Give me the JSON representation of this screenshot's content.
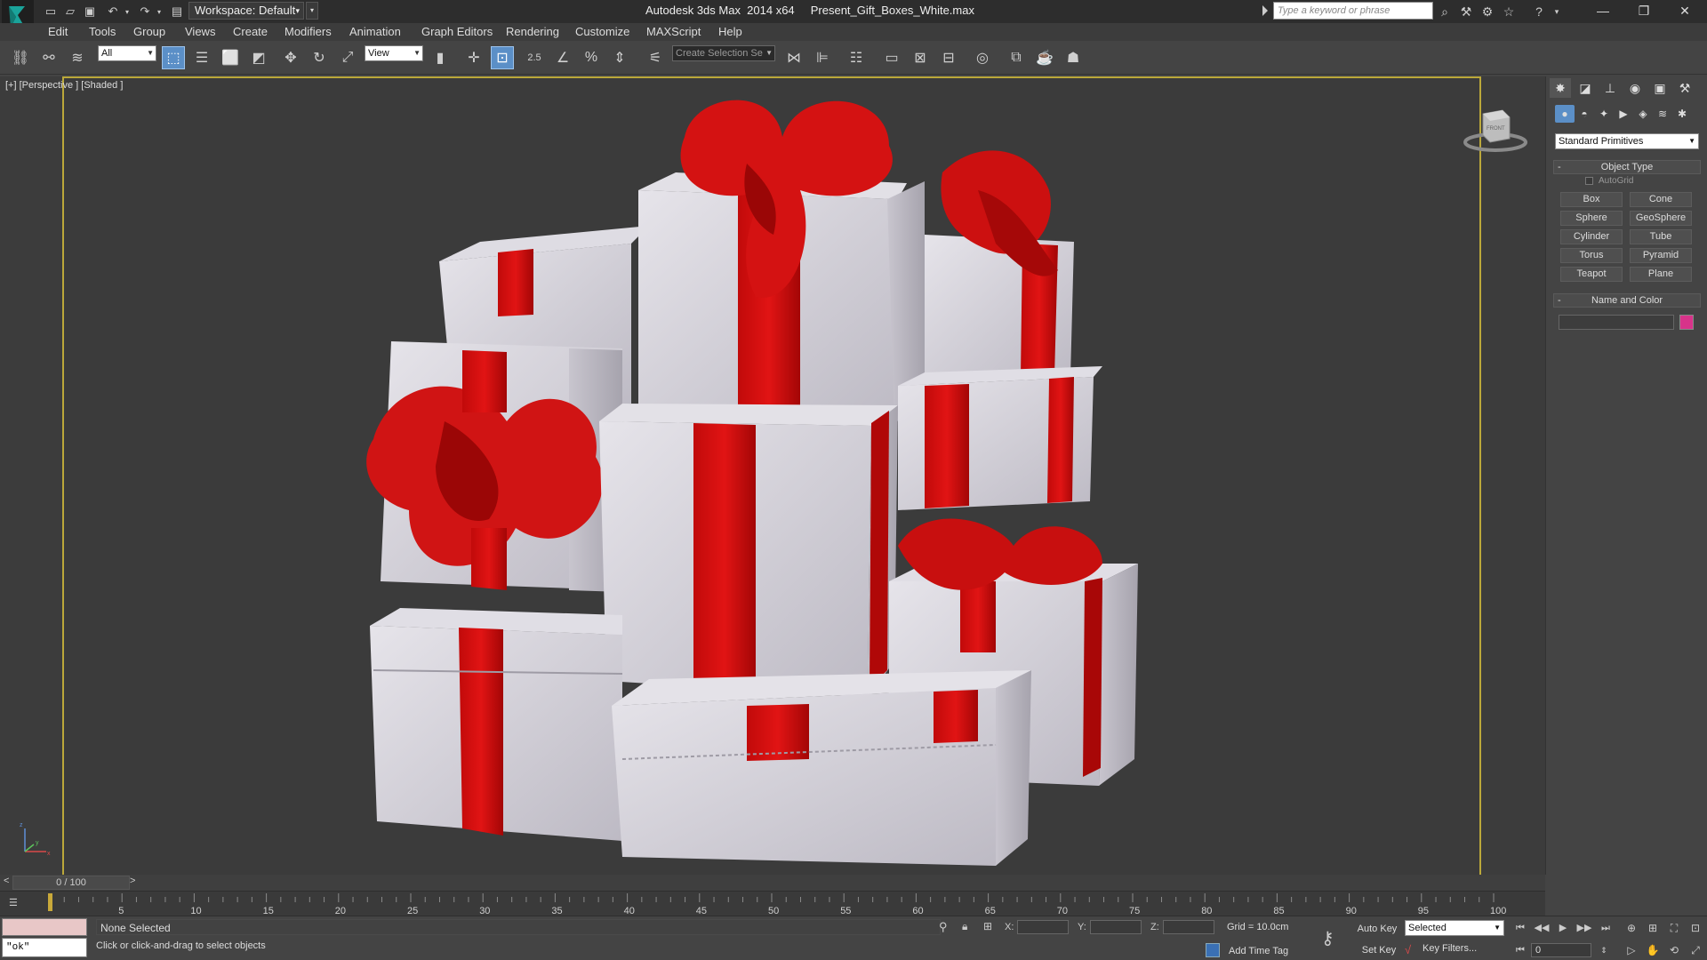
{
  "titlebar": {
    "workspace_label": "Workspace: Default",
    "app_title": "Autodesk 3ds Max  2014 x64",
    "file_name": "Present_Gift_Boxes_White.max",
    "search_placeholder": "Type a keyword or phrase"
  },
  "menu": [
    "Edit",
    "Tools",
    "Group",
    "Views",
    "Create",
    "Modifiers",
    "Animation",
    "Graph Editors",
    "Rendering",
    "Customize",
    "MAXScript",
    "Help"
  ],
  "toolbar": {
    "selection_filter": "All",
    "ref_coord": "View",
    "snap_value": "2.5",
    "named_selection_placeholder": "Create Selection Se"
  },
  "viewport": {
    "label": "[+] [Perspective ] [Shaded ]",
    "viewcube_label": "FRONT"
  },
  "command_panel": {
    "category": "Standard Primitives",
    "object_type_header": "Object Type",
    "autogrid_label": "AutoGrid",
    "buttons": [
      "Box",
      "Cone",
      "Sphere",
      "GeoSphere",
      "Cylinder",
      "Tube",
      "Torus",
      "Pyramid",
      "Teapot",
      "Plane"
    ],
    "name_color_header": "Name and Color",
    "color_swatch": "#d8338a"
  },
  "timeline": {
    "frame_display": "0 / 100",
    "ticks": [
      "5",
      "10",
      "15",
      "20",
      "25",
      "30",
      "35",
      "40",
      "45",
      "50",
      "55",
      "60",
      "65",
      "70",
      "75",
      "80",
      "85",
      "90",
      "95",
      "100"
    ]
  },
  "status": {
    "maxscript_output": "\"ok\"",
    "selection": "None Selected",
    "prompt": "Click or click-and-drag to select objects",
    "x_label": "X:",
    "y_label": "Y:",
    "z_label": "Z:",
    "grid": "Grid = 10.0cm",
    "add_time_tag": "Add Time Tag",
    "auto_key": "Auto Key",
    "set_key": "Set Key",
    "key_mode": "Selected",
    "key_filters": "Key Filters...",
    "current_frame": "0"
  }
}
